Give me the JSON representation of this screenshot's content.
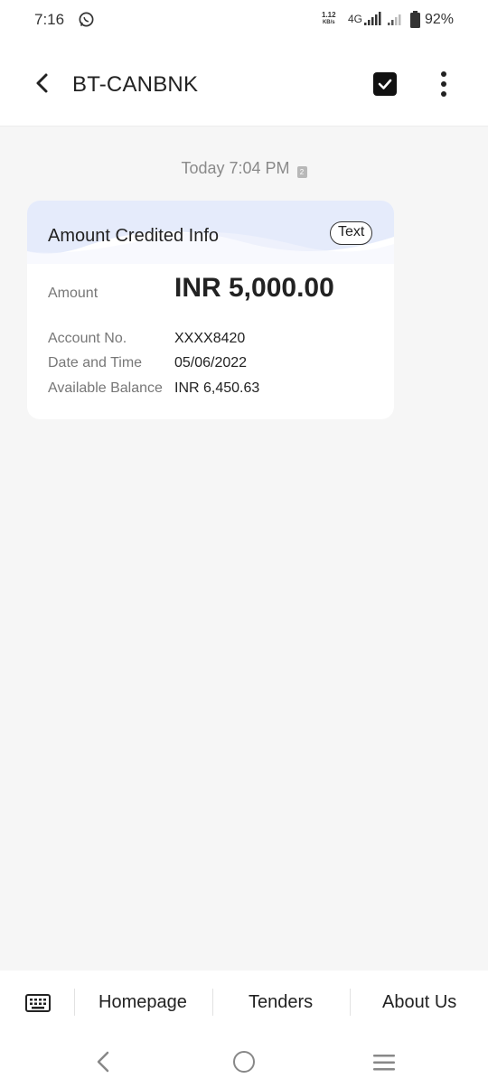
{
  "status_bar": {
    "time": "7:16",
    "whatsapp_icon": "whatsapp-icon",
    "speed_value": "1.12",
    "speed_unit": "KB/s",
    "network": "4G",
    "battery": "92%"
  },
  "app_bar": {
    "title": "BT-CANBNK",
    "back_icon": "back-arrow-icon",
    "select_icon": "checkbox-icon",
    "more_icon": "more-vert-icon"
  },
  "conversation": {
    "timestamp": "Today 7:04 PM",
    "sim_badge": "2"
  },
  "card": {
    "title": "Amount Credited Info",
    "chip_label": "Text",
    "amount_label": "Amount",
    "amount_value": "INR 5,000.00",
    "rows": [
      {
        "label": "Account No.",
        "value": "XXXX8420"
      },
      {
        "label": "Date and Time",
        "value": "05/06/2022"
      },
      {
        "label": "Available Balance",
        "value": "INR 6,450.63"
      }
    ]
  },
  "bottom_menu": {
    "keyboard_icon": "keyboard-icon",
    "items": [
      "Homepage",
      "Tenders",
      "About Us"
    ]
  },
  "nav_bar": {
    "back": "nav-back-icon",
    "home": "nav-home-icon",
    "recents": "nav-recents-icon"
  },
  "colors": {
    "background": "#f6f6f6",
    "card_wave": "#e3e9fb",
    "text_primary": "#222222",
    "text_secondary": "#777777"
  }
}
